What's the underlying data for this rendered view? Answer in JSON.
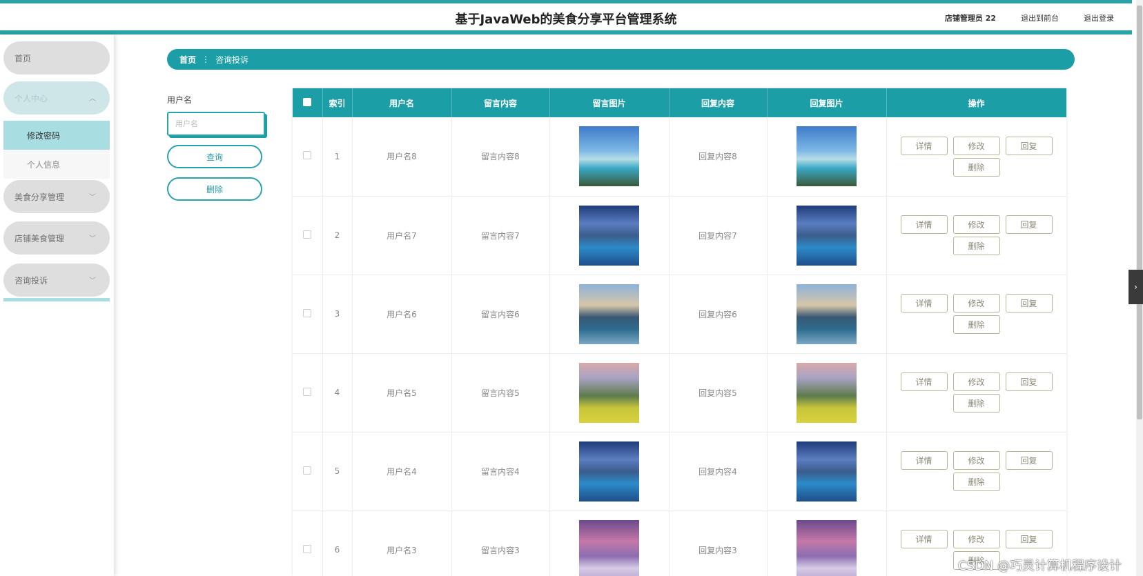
{
  "header": {
    "title": "基于JavaWeb的美食分享平台管理系统",
    "user": "店铺管理员 22",
    "to_front": "退出到前台",
    "logout": "退出登录"
  },
  "sidebar": {
    "home": "首页",
    "personal_center": "个人中心",
    "change_password": "修改密码",
    "personal_info": "个人信息",
    "food_share_mgmt": "美食分享管理",
    "shop_food_mgmt": "店铺美食管理",
    "consult_complaint": "咨询投诉"
  },
  "breadcrumb": {
    "home": "首页",
    "separator": "⋮",
    "current": "咨询投诉"
  },
  "search": {
    "label": "用户名",
    "placeholder": "用户名",
    "query_button": "查询",
    "delete_button": "删除"
  },
  "table": {
    "headers": {
      "index": "索引",
      "username": "用户名",
      "message": "留言内容",
      "message_image": "留言图片",
      "reply": "回复内容",
      "reply_image": "回复图片",
      "actions": "操作"
    },
    "actions": {
      "detail": "详情",
      "edit": "修改",
      "reply": "回复",
      "delete": "删除"
    },
    "rows": [
      {
        "index": "1",
        "username": "用户名8",
        "message": "留言内容8",
        "reply": "回复内容8",
        "image": "beach"
      },
      {
        "index": "2",
        "username": "用户名7",
        "message": "留言内容7",
        "reply": "回复内容7",
        "image": "lake"
      },
      {
        "index": "3",
        "username": "用户名6",
        "message": "留言内容6",
        "reply": "回复内容6",
        "image": "mountain"
      },
      {
        "index": "4",
        "username": "用户名5",
        "message": "留言内容5",
        "reply": "回复内容5",
        "image": "field"
      },
      {
        "index": "5",
        "username": "用户名4",
        "message": "留言内容4",
        "reply": "回复内容4",
        "image": "lake"
      },
      {
        "index": "6",
        "username": "用户名3",
        "message": "留言内容3",
        "reply": "回复内容3",
        "image": "snow"
      }
    ]
  },
  "watermark": "CSDN @巧灵计算机程序设计",
  "colors": {
    "accent": "#1c9ea6",
    "sidebar_pill": "#dedede",
    "sidebar_selected": "#a8dde2"
  }
}
